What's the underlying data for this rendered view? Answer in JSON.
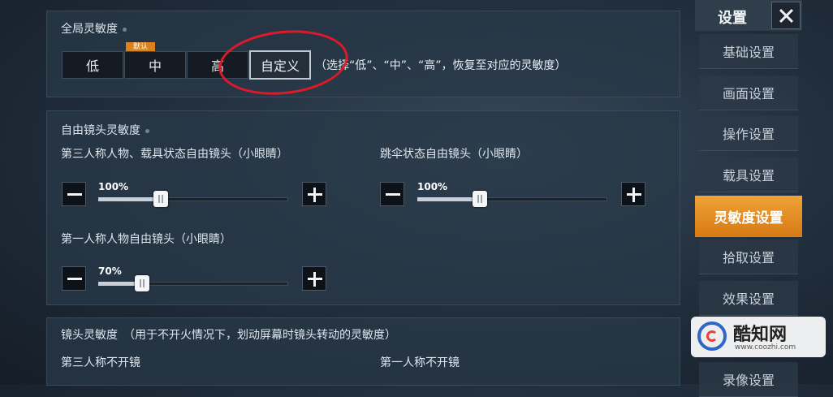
{
  "global": {
    "title": "全局灵敏度",
    "default_badge": "默认",
    "options": [
      "低",
      "中",
      "高",
      "自定义"
    ],
    "selected": "自定义",
    "hint": "（选择“低”、“中”、“高”，恢复至对应的灵敏度）"
  },
  "free_camera": {
    "title": "自由镜头灵敏度",
    "third_person_label": "第三人称人物、载具状态自由镜头（小眼睛）",
    "third_person_value": "100%",
    "third_person_level": 0.33,
    "parachute_label": "跳伞状态自由镜头（小眼睛）",
    "parachute_value": "100%",
    "parachute_level": 0.33,
    "first_person_label": "第一人称人物自由镜头（小眼睛）",
    "first_person_value": "70%",
    "first_person_level": 0.23
  },
  "lens": {
    "title": "镜头灵敏度　（用于不开火情况下，划动屏幕时镜头转动的灵敏度）",
    "third_person_label": "第三人称不开镜",
    "first_person_label": "第一人称不开镜"
  },
  "nav": {
    "title": "设置",
    "items": [
      "基础设置",
      "画面设置",
      "操作设置",
      "载具设置",
      "灵敏度设置",
      "拾取设置",
      "效果设置",
      "录像设置"
    ],
    "active": "灵敏度设置"
  },
  "watermark": {
    "name": "酷知网",
    "url": "www.coozhi.com"
  },
  "colors": {
    "accent": "#e8902a",
    "annotation": "#e0192a"
  }
}
